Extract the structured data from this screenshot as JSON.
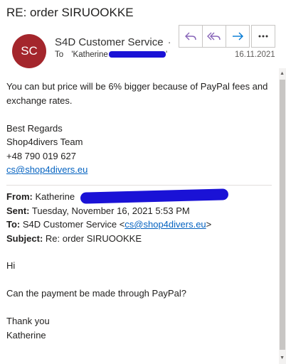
{
  "subject": "RE: order SIRUOOKKE",
  "avatar": {
    "initials": "SC",
    "color": "#a4262c"
  },
  "sender": {
    "name": "S4D Customer Service",
    "dot": "·"
  },
  "to": {
    "label": "To",
    "name": "'Katherine",
    "close_quote": "'"
  },
  "date": "16.11.2021",
  "actions": {
    "reply": "reply-icon",
    "reply_all": "reply-all-icon",
    "forward": "forward-icon",
    "more": "more-icon"
  },
  "body": {
    "line1": "You can but price will be 6% bigger because of PayPal fees and exchange rates.",
    "sign1": "Best Regards",
    "sign2": "Shop4divers Team",
    "phone": "+48 790 019 627",
    "email": "cs@shop4divers.eu"
  },
  "quoted": {
    "from_label": "From:",
    "from_value": "Katherine",
    "sent_label": "Sent:",
    "sent_value": "Tuesday, November 16, 2021 5:53 PM",
    "to_label": "To:",
    "to_value_prefix": "S4D Customer Service <",
    "to_email": "cs@shop4divers.eu",
    "to_value_suffix": ">",
    "subject_label": "Subject:",
    "subject_value": "Re: order SIRUOOKKE"
  },
  "reply": {
    "greeting": "Hi",
    "question": "Can the payment be made through PayPal?",
    "thanks": "Thank you",
    "name": "Katherine"
  },
  "colors": {
    "accent": "#8764b8",
    "link": "#0563c1",
    "redaction": "#1a12d6"
  }
}
